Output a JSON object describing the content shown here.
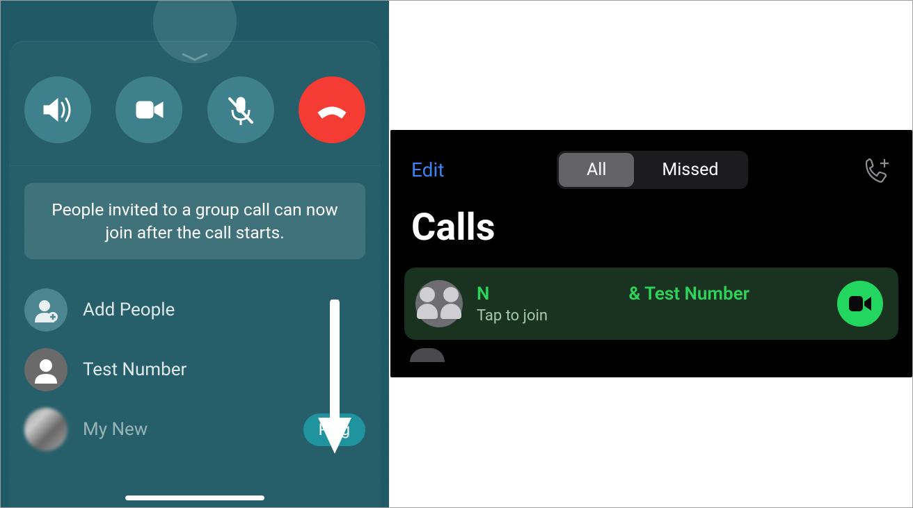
{
  "left": {
    "banner_text": "People invited to a group call can now join after the call starts.",
    "toolbar": {
      "speaker_name": "speaker-icon",
      "video_name": "video-icon",
      "mute_name": "mic-off-icon",
      "end_name": "end-call-icon"
    },
    "rows": {
      "add_people_label": "Add People",
      "test_number_label": "Test Number",
      "my_new_label": "My New",
      "ring_label": "Ring"
    }
  },
  "right": {
    "edit_label": "Edit",
    "seg_all": "All",
    "seg_missed": "Missed",
    "title": "Calls",
    "call_title_left": "N",
    "call_title_right": "& Test Number",
    "call_sub": "Tap to join"
  }
}
